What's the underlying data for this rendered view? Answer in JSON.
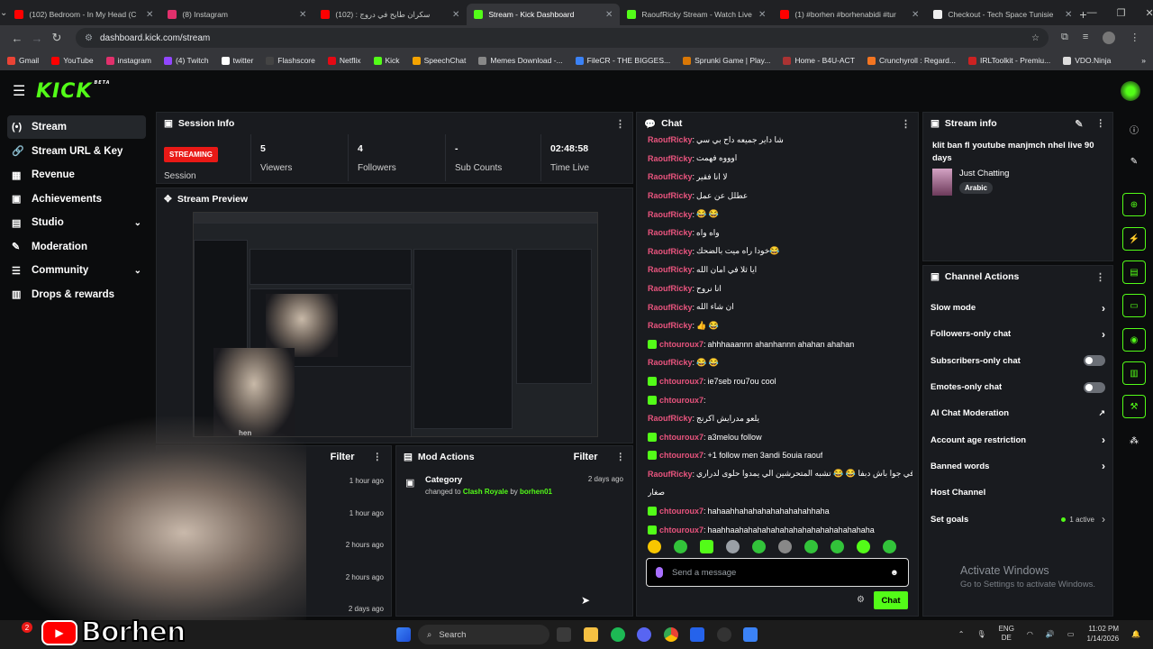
{
  "browser": {
    "tabs": [
      {
        "title": "(102) Bedroom - In My Head (C",
        "fav_color": "#ff0000"
      },
      {
        "title": "(8) Instagram",
        "fav_color": "#e1306c"
      },
      {
        "title": "سكران طايح في دروج : (102)",
        "fav_color": "#ff0000"
      },
      {
        "title": "Stream - Kick Dashboard",
        "fav_color": "#53fc18"
      },
      {
        "title": "RaoufRicky Stream - Watch Live",
        "fav_color": "#53fc18"
      },
      {
        "title": "(1) #borhen #borhenabidi #tur",
        "fav_color": "#ff0000"
      },
      {
        "title": "Checkout - Tech Space Tunisie",
        "fav_color": "#eeeeee"
      }
    ],
    "url": "dashboard.kick.com/stream",
    "bookmarks": [
      {
        "label": "Gmail",
        "color": "#ea4335"
      },
      {
        "label": "YouTube",
        "color": "#ff0000"
      },
      {
        "label": "instagram",
        "color": "#e1306c"
      },
      {
        "label": "(4) Twitch",
        "color": "#9146ff"
      },
      {
        "label": "twitter",
        "color": "#ffffff"
      },
      {
        "label": "Flashscore",
        "color": "#444444"
      },
      {
        "label": "Netflix",
        "color": "#e50914"
      },
      {
        "label": "Kick",
        "color": "#53fc18"
      },
      {
        "label": "SpeechChat",
        "color": "#f4a300"
      },
      {
        "label": "Memes Download -...",
        "color": "#888888"
      },
      {
        "label": "FileCR - THE BIGGES...",
        "color": "#3b82f6"
      },
      {
        "label": "Sprunki Game | Play...",
        "color": "#d97706"
      },
      {
        "label": "Home - B4U-ACT",
        "color": "#aa3333"
      },
      {
        "label": "Crunchyroll : Regard...",
        "color": "#f47521"
      },
      {
        "label": "IRLToolkit - Premiu...",
        "color": "#cc2222"
      },
      {
        "label": "VDO.Ninja",
        "color": "#dddddd"
      }
    ]
  },
  "kick": {
    "logo": "KICK",
    "logo_beta": "BETA",
    "nav": [
      {
        "label": "Stream",
        "icon": "(•)",
        "active": true,
        "chevron": false
      },
      {
        "label": "Stream URL & Key",
        "icon": "🔗",
        "active": false,
        "chevron": false
      },
      {
        "label": "Revenue",
        "icon": "▦",
        "active": false,
        "chevron": false
      },
      {
        "label": "Achievements",
        "icon": "▣",
        "active": false,
        "chevron": false
      },
      {
        "label": "Studio",
        "icon": "▤",
        "active": false,
        "chevron": true
      },
      {
        "label": "Moderation",
        "icon": "✎",
        "active": false,
        "chevron": false
      },
      {
        "label": "Community",
        "icon": "☰",
        "active": false,
        "chevron": true
      },
      {
        "label": "Drops & rewards",
        "icon": "▥",
        "active": false,
        "chevron": false
      }
    ]
  },
  "session": {
    "title": "Session Info",
    "status": "STREAMING",
    "status_label": "Session",
    "stats": [
      {
        "value": "5",
        "label": "Viewers"
      },
      {
        "value": "4",
        "label": "Followers"
      },
      {
        "value": "-",
        "label": "Sub Counts"
      },
      {
        "value": "02:48:58",
        "label": "Time Live"
      }
    ]
  },
  "preview": {
    "title": "Stream Preview"
  },
  "activity": {
    "filter": "Filter",
    "items": [
      {
        "time": "1 hour ago",
        "text": "hannel"
      },
      {
        "time": "1 hour ago",
        "text": "hannel"
      },
      {
        "time": "2 hours ago",
        "text": ""
      },
      {
        "time": "2 hours ago",
        "text": ""
      },
      {
        "time": "2 days ago",
        "text": ""
      }
    ]
  },
  "mod_actions": {
    "title": "Mod Actions",
    "filter": "Filter",
    "item": {
      "title": "Category",
      "prefix": "changed to",
      "game": "Clash Royale",
      "by": "by",
      "user": "borhen01",
      "time": "2 days ago"
    }
  },
  "chat": {
    "title": "Chat",
    "messages": [
      {
        "user": "RaoufRicky",
        "text": "شا داير جميعه داح بي سي",
        "badge": false
      },
      {
        "user": "RaoufRicky",
        "text": "اوووه فهمت",
        "badge": false
      },
      {
        "user": "RaoufRicky",
        "text": "لا انا فقير",
        "badge": false
      },
      {
        "user": "RaoufRicky",
        "text": "عطلل عن عمل",
        "badge": false
      },
      {
        "user": "RaoufRicky",
        "text": "😂 😂",
        "badge": false
      },
      {
        "user": "RaoufRicky",
        "text": "واه واه",
        "badge": false
      },
      {
        "user": "RaoufRicky",
        "text": "خودا راه ميت بالضحك😂",
        "badge": false
      },
      {
        "user": "RaoufRicky",
        "text": "ايا ثلا في امان الله",
        "badge": false
      },
      {
        "user": "RaoufRicky",
        "text": "انا نروح",
        "badge": false
      },
      {
        "user": "RaoufRicky",
        "text": "ان شاء الله",
        "badge": false
      },
      {
        "user": "RaoufRicky",
        "text": "👍 😂",
        "badge": false
      },
      {
        "user": "chtouroux7",
        "text": "ahhhaaannn ahanhannn ahahan ahahan",
        "badge": true
      },
      {
        "user": "RaoufRicky",
        "text": "😂 😂",
        "badge": false
      },
      {
        "user": "chtouroux7",
        "text": "ie7seb rou7ou cool",
        "badge": true
      },
      {
        "user": "chtouroux7",
        "text": "",
        "badge": true
      },
      {
        "user": "RaoufRicky",
        "text": "يلعو مدرايش اكرنج",
        "badge": false
      },
      {
        "user": "chtouroux7",
        "text": "a3melou follow",
        "badge": true
      },
      {
        "user": "chtouroux7",
        "text": "+1 follow men 3andi 5ouia raouf",
        "badge": true
      },
      {
        "user": "RaoufRicky",
        "text": "ز عما ديلي في جوا باش دبفا 😂 😂 تشبه المتحرشين الي يمدوا حلوى لدراري",
        "badge": false
      },
      {
        "user": "",
        "text": "صغار",
        "badge": false
      },
      {
        "user": "chtouroux7",
        "text": "hahaahhahahahahahahahahhaha",
        "badge": true
      },
      {
        "user": "chtouroux7",
        "text": "haahhaahahahahahahahahahahahahahahaha",
        "badge": true
      }
    ],
    "placeholder": "Send a message",
    "send": "Chat"
  },
  "stream_info": {
    "title": "Stream info",
    "stream_title": "klit ban fl youtube manjmch nhel live 90 days",
    "category": "Just Chatting",
    "tag": "Arabic"
  },
  "channel_actions": {
    "title": "Channel Actions",
    "rows": [
      {
        "label": "Slow mode",
        "kind": "chevron"
      },
      {
        "label": "Followers-only chat",
        "kind": "chevron"
      },
      {
        "label": "Subscribers-only chat",
        "kind": "toggle"
      },
      {
        "label": "Emotes-only chat",
        "kind": "toggle"
      },
      {
        "label": "AI Chat Moderation",
        "kind": "ext"
      },
      {
        "label": "Account age restriction",
        "kind": "chevron"
      },
      {
        "label": "Banned words",
        "kind": "chevron"
      },
      {
        "label": "Host Channel",
        "kind": "none"
      },
      {
        "label": "Set goals",
        "kind": "active"
      }
    ],
    "active_text": "1 active"
  },
  "windows": {
    "activate_title": "Activate Windows",
    "activate_sub": "Go to Settings to activate Windows.",
    "search": "Search",
    "lang": "ENG",
    "lang2": "DE",
    "time": "11:02 PM",
    "date": "1/14/2026"
  },
  "overlay": {
    "name": "Borhen",
    "preview_caption": "hen",
    "badge_count": "2"
  }
}
